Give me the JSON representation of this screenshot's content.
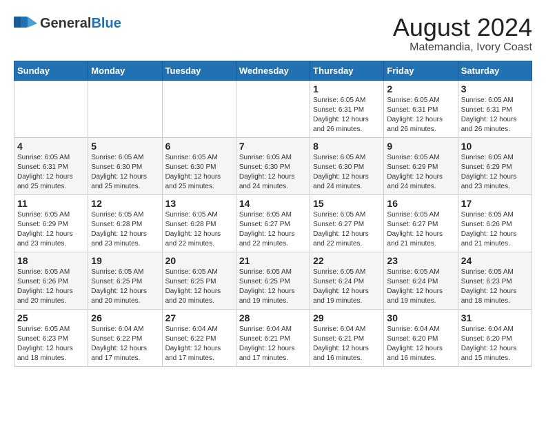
{
  "header": {
    "logo_general": "General",
    "logo_blue": "Blue",
    "title": "August 2024",
    "subtitle": "Matemandia, Ivory Coast"
  },
  "weekdays": [
    "Sunday",
    "Monday",
    "Tuesday",
    "Wednesday",
    "Thursday",
    "Friday",
    "Saturday"
  ],
  "weeks": [
    [
      {
        "day": "",
        "info": ""
      },
      {
        "day": "",
        "info": ""
      },
      {
        "day": "",
        "info": ""
      },
      {
        "day": "",
        "info": ""
      },
      {
        "day": "1",
        "info": "Sunrise: 6:05 AM\nSunset: 6:31 PM\nDaylight: 12 hours\nand 26 minutes."
      },
      {
        "day": "2",
        "info": "Sunrise: 6:05 AM\nSunset: 6:31 PM\nDaylight: 12 hours\nand 26 minutes."
      },
      {
        "day": "3",
        "info": "Sunrise: 6:05 AM\nSunset: 6:31 PM\nDaylight: 12 hours\nand 26 minutes."
      }
    ],
    [
      {
        "day": "4",
        "info": "Sunrise: 6:05 AM\nSunset: 6:31 PM\nDaylight: 12 hours\nand 25 minutes."
      },
      {
        "day": "5",
        "info": "Sunrise: 6:05 AM\nSunset: 6:30 PM\nDaylight: 12 hours\nand 25 minutes."
      },
      {
        "day": "6",
        "info": "Sunrise: 6:05 AM\nSunset: 6:30 PM\nDaylight: 12 hours\nand 25 minutes."
      },
      {
        "day": "7",
        "info": "Sunrise: 6:05 AM\nSunset: 6:30 PM\nDaylight: 12 hours\nand 24 minutes."
      },
      {
        "day": "8",
        "info": "Sunrise: 6:05 AM\nSunset: 6:30 PM\nDaylight: 12 hours\nand 24 minutes."
      },
      {
        "day": "9",
        "info": "Sunrise: 6:05 AM\nSunset: 6:29 PM\nDaylight: 12 hours\nand 24 minutes."
      },
      {
        "day": "10",
        "info": "Sunrise: 6:05 AM\nSunset: 6:29 PM\nDaylight: 12 hours\nand 23 minutes."
      }
    ],
    [
      {
        "day": "11",
        "info": "Sunrise: 6:05 AM\nSunset: 6:29 PM\nDaylight: 12 hours\nand 23 minutes."
      },
      {
        "day": "12",
        "info": "Sunrise: 6:05 AM\nSunset: 6:28 PM\nDaylight: 12 hours\nand 23 minutes."
      },
      {
        "day": "13",
        "info": "Sunrise: 6:05 AM\nSunset: 6:28 PM\nDaylight: 12 hours\nand 22 minutes."
      },
      {
        "day": "14",
        "info": "Sunrise: 6:05 AM\nSunset: 6:27 PM\nDaylight: 12 hours\nand 22 minutes."
      },
      {
        "day": "15",
        "info": "Sunrise: 6:05 AM\nSunset: 6:27 PM\nDaylight: 12 hours\nand 22 minutes."
      },
      {
        "day": "16",
        "info": "Sunrise: 6:05 AM\nSunset: 6:27 PM\nDaylight: 12 hours\nand 21 minutes."
      },
      {
        "day": "17",
        "info": "Sunrise: 6:05 AM\nSunset: 6:26 PM\nDaylight: 12 hours\nand 21 minutes."
      }
    ],
    [
      {
        "day": "18",
        "info": "Sunrise: 6:05 AM\nSunset: 6:26 PM\nDaylight: 12 hours\nand 20 minutes."
      },
      {
        "day": "19",
        "info": "Sunrise: 6:05 AM\nSunset: 6:25 PM\nDaylight: 12 hours\nand 20 minutes."
      },
      {
        "day": "20",
        "info": "Sunrise: 6:05 AM\nSunset: 6:25 PM\nDaylight: 12 hours\nand 20 minutes."
      },
      {
        "day": "21",
        "info": "Sunrise: 6:05 AM\nSunset: 6:25 PM\nDaylight: 12 hours\nand 19 minutes."
      },
      {
        "day": "22",
        "info": "Sunrise: 6:05 AM\nSunset: 6:24 PM\nDaylight: 12 hours\nand 19 minutes."
      },
      {
        "day": "23",
        "info": "Sunrise: 6:05 AM\nSunset: 6:24 PM\nDaylight: 12 hours\nand 19 minutes."
      },
      {
        "day": "24",
        "info": "Sunrise: 6:05 AM\nSunset: 6:23 PM\nDaylight: 12 hours\nand 18 minutes."
      }
    ],
    [
      {
        "day": "25",
        "info": "Sunrise: 6:05 AM\nSunset: 6:23 PM\nDaylight: 12 hours\nand 18 minutes."
      },
      {
        "day": "26",
        "info": "Sunrise: 6:04 AM\nSunset: 6:22 PM\nDaylight: 12 hours\nand 17 minutes."
      },
      {
        "day": "27",
        "info": "Sunrise: 6:04 AM\nSunset: 6:22 PM\nDaylight: 12 hours\nand 17 minutes."
      },
      {
        "day": "28",
        "info": "Sunrise: 6:04 AM\nSunset: 6:21 PM\nDaylight: 12 hours\nand 17 minutes."
      },
      {
        "day": "29",
        "info": "Sunrise: 6:04 AM\nSunset: 6:21 PM\nDaylight: 12 hours\nand 16 minutes."
      },
      {
        "day": "30",
        "info": "Sunrise: 6:04 AM\nSunset: 6:20 PM\nDaylight: 12 hours\nand 16 minutes."
      },
      {
        "day": "31",
        "info": "Sunrise: 6:04 AM\nSunset: 6:20 PM\nDaylight: 12 hours\nand 15 minutes."
      }
    ]
  ]
}
